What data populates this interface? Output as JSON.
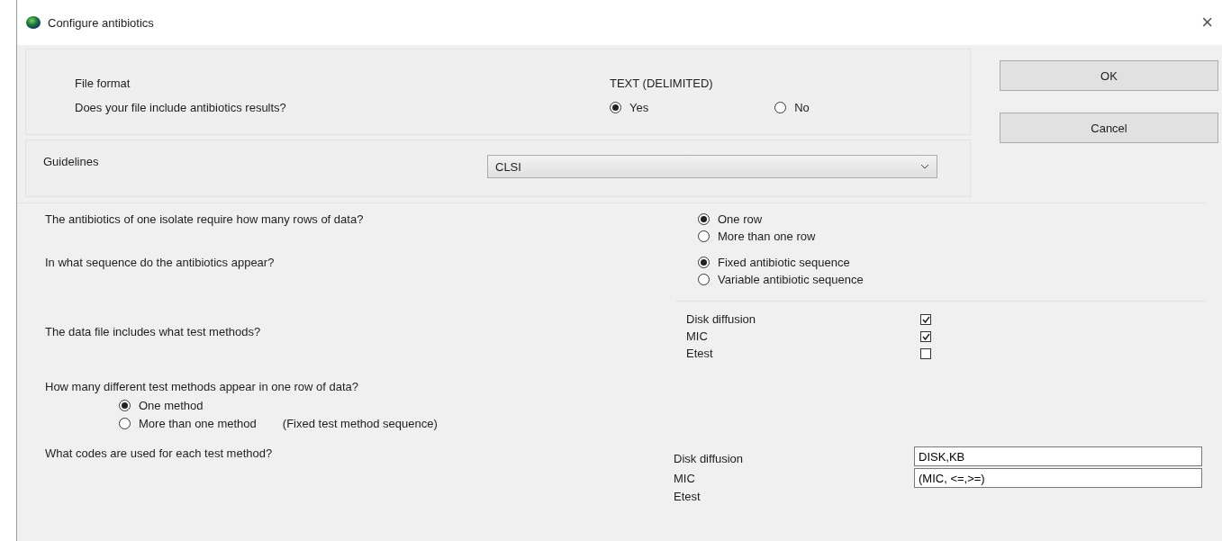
{
  "window": {
    "title": "Configure antibiotics",
    "close": "×"
  },
  "file_format": {
    "label": "File format",
    "value": "TEXT (DELIMITED)"
  },
  "results_question": {
    "label": "Does your file include antibiotics results?",
    "options": [
      {
        "label": "Yes",
        "selected": true
      },
      {
        "label": "No",
        "selected": false
      }
    ]
  },
  "buttons": [
    {
      "label": "OK"
    },
    {
      "label": "Cancel"
    }
  ],
  "guidelines": {
    "label": "Guidelines",
    "value": "CLSI"
  },
  "rows_question": {
    "label": "The antibiotics of one isolate require how many rows of data?",
    "options": [
      {
        "label": "One row",
        "selected": true
      },
      {
        "label": "More than one row",
        "selected": false
      }
    ]
  },
  "sequence_question": {
    "label": "In what sequence do the antibiotics appear?",
    "options": [
      {
        "label": "Fixed antibiotic sequence",
        "selected": true
      },
      {
        "label": "Variable antibiotic sequence",
        "selected": false
      }
    ]
  },
  "methods_question": {
    "label": "The data file includes what test methods?",
    "items": [
      {
        "label": "Disk diffusion",
        "checked": true
      },
      {
        "label": "MIC",
        "checked": true
      },
      {
        "label": "Etest",
        "checked": false
      }
    ]
  },
  "per_row_question": {
    "label": "How many different test methods appear in one row of data?",
    "options": [
      {
        "label": "One method",
        "selected": true
      },
      {
        "label": "More than one method",
        "note": "(Fixed test method sequence)",
        "selected": false
      }
    ]
  },
  "codes_question": {
    "label": "What codes are used for each test method?",
    "items": [
      {
        "label": "Disk diffusion",
        "value": "DISK,KB"
      },
      {
        "label": "MIC",
        "value": "(MIC, <=,>=)"
      },
      {
        "label": "Etest"
      }
    ]
  }
}
